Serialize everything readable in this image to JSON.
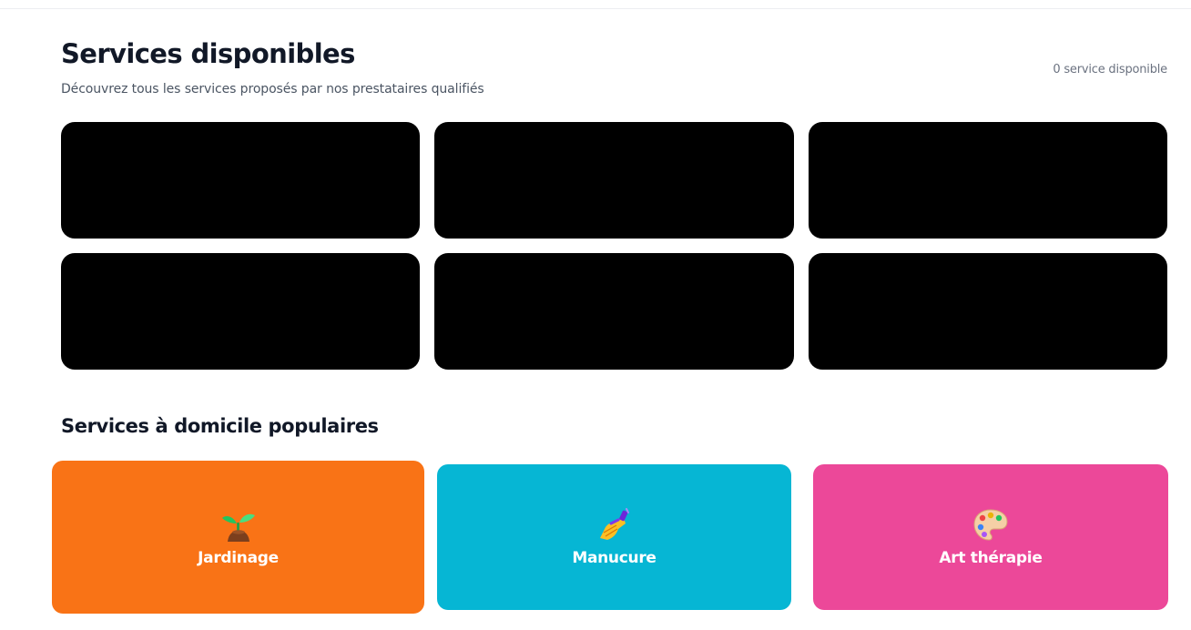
{
  "header": {
    "title": "Services disponibles",
    "subtitle": "Découvrez tous les services proposés par nos prestataires qualifiés",
    "count_label": "0 service disponible"
  },
  "placeholders": {
    "count": 6,
    "color": "#000000"
  },
  "popular": {
    "title": "Services à domicile populaires",
    "items": [
      {
        "label": "Jardinage",
        "icon": "seedling-icon",
        "color": "#f97316"
      },
      {
        "label": "Manucure",
        "icon": "nail-polish-icon",
        "color": "#06b6d4"
      },
      {
        "label": "Art thérapie",
        "icon": "artist-palette-icon",
        "color": "#ec4899"
      }
    ]
  }
}
